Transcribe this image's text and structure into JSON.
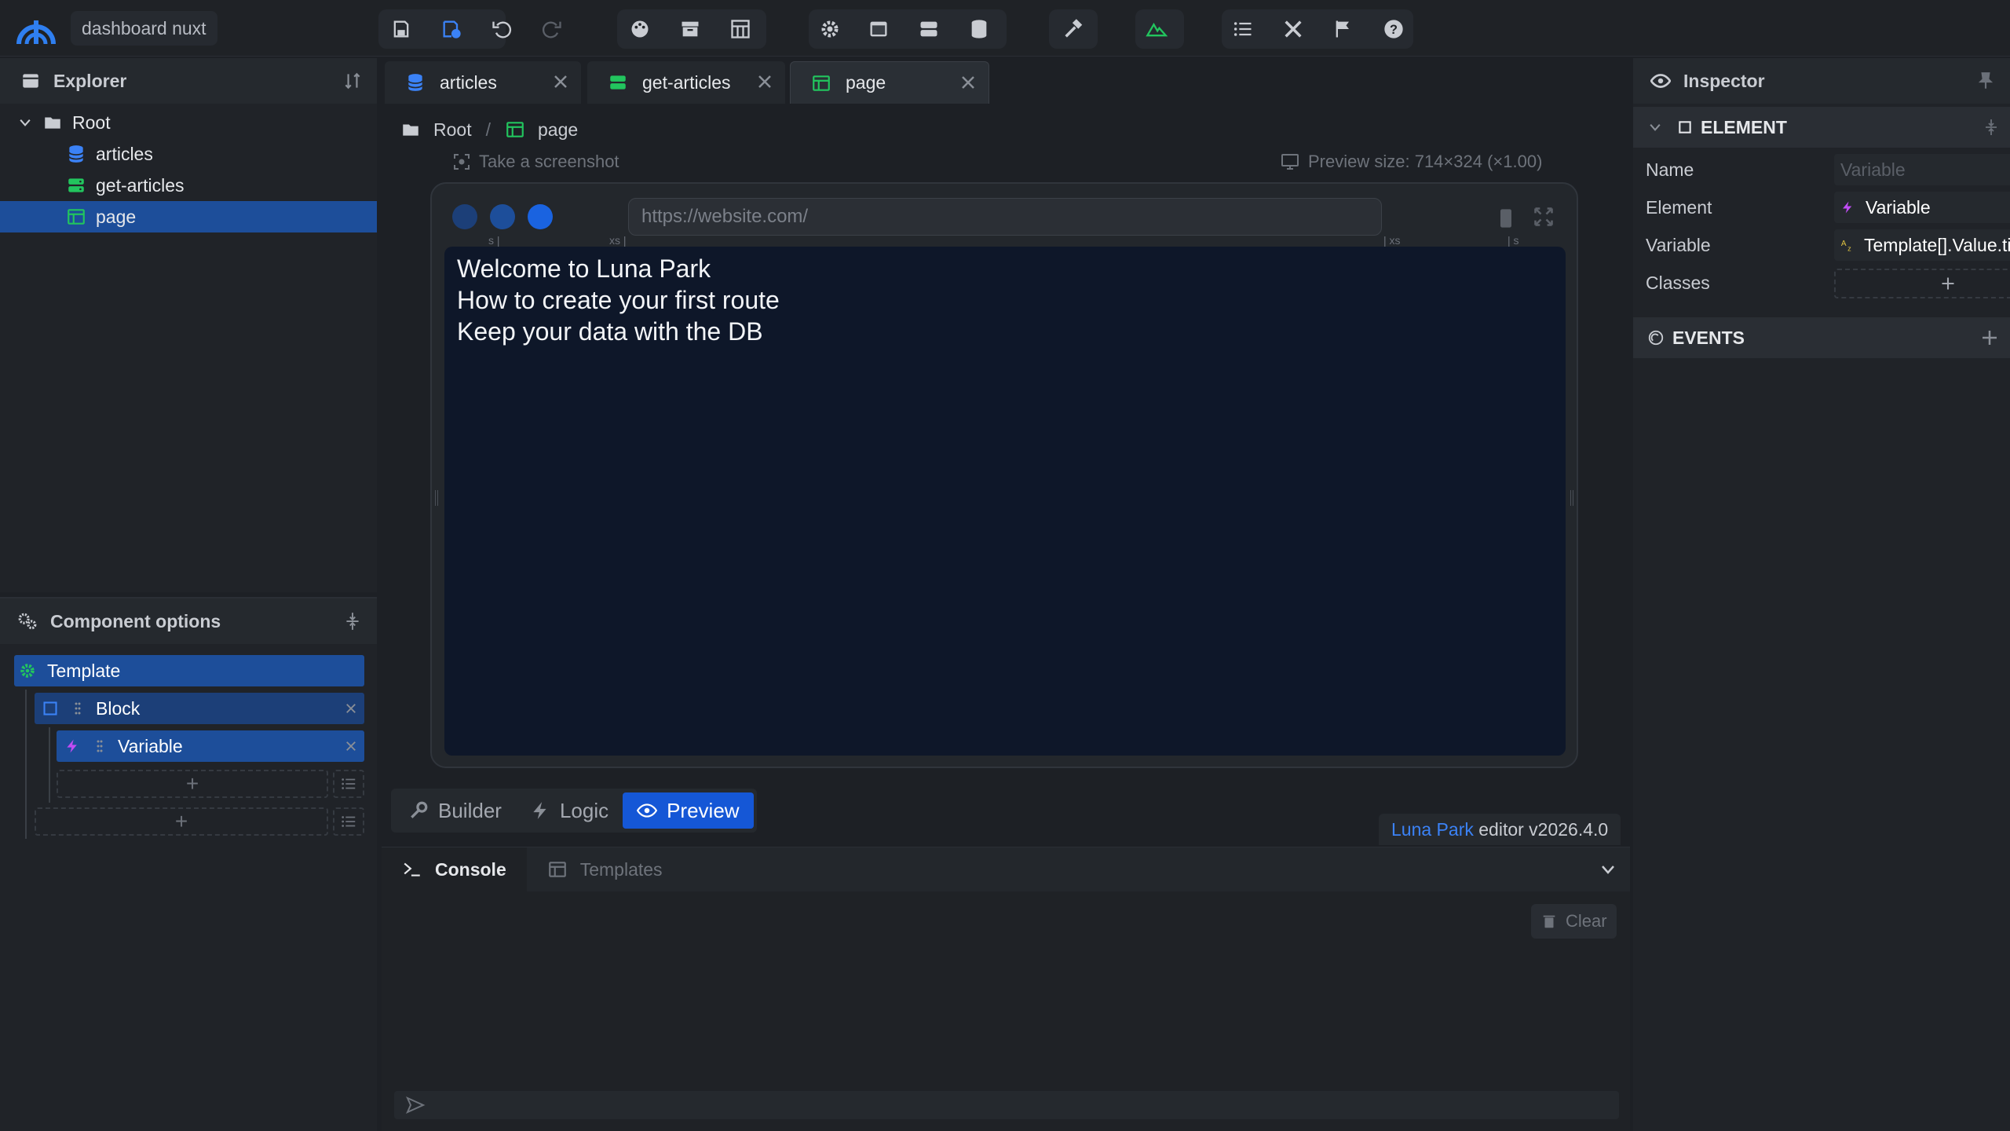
{
  "topbar": {
    "project_name": "dashboard nuxt",
    "icons": [
      "save-icon",
      "save-deploy-icon",
      "undo-icon",
      "redo-icon",
      "palette-icon",
      "archive-icon",
      "layout-icon",
      "gear-icon",
      "window-icon",
      "server-icon",
      "database-icon",
      "hammer-icon",
      "nuxt-icon",
      "list-icon",
      "tools-icon",
      "flag-icon",
      "help-icon"
    ]
  },
  "explorer": {
    "title": "Explorer",
    "root_label": "Root",
    "items": [
      {
        "label": "articles",
        "icon": "database-icon",
        "color": "#3b82f6"
      },
      {
        "label": "get-articles",
        "icon": "server-icon",
        "color": "#22c55e"
      },
      {
        "label": "page",
        "icon": "page-icon",
        "color": "#22c55e"
      }
    ]
  },
  "component_options": {
    "title": "Component options",
    "template_label": "Template",
    "block_label": "Block",
    "variable_label": "Variable",
    "add_symbol": "+"
  },
  "tabs": [
    {
      "label": "articles",
      "icon": "database-icon"
    },
    {
      "label": "get-articles",
      "icon": "server-icon"
    },
    {
      "label": "page",
      "icon": "page-icon"
    }
  ],
  "breadcrumb": {
    "root": "Root",
    "sep": "/",
    "current": "page"
  },
  "preview": {
    "screenshot_label": "Take a screenshot",
    "size_label": "Preview size: 714×324 (×1.00)",
    "url": "https://website.com/",
    "ruler": {
      "s_left": "s |",
      "xs_left": "xs |",
      "xs_right": "| xs",
      "s_right": "| s"
    },
    "content": [
      "Welcome to Luna Park",
      "How to create your first route",
      "Keep your data with the DB"
    ]
  },
  "modes": {
    "builder": "Builder",
    "logic": "Logic",
    "preview": "Preview"
  },
  "version": {
    "brand": "Luna Park",
    "text": " editor v2026.4.0"
  },
  "console": {
    "tab_console": "Console",
    "tab_templates": "Templates",
    "clear": "Clear"
  },
  "inspector": {
    "title": "Inspector",
    "element_section": "ELEMENT",
    "events_section": "EVENTS",
    "props": {
      "name_label": "Name",
      "name_placeholder": "Variable",
      "element_label": "Element",
      "element_value": "Variable",
      "variable_label": "Variable",
      "variable_value": "Template[].Value.title",
      "classes_label": "Classes"
    }
  },
  "colors": {
    "accent": "#1557d6",
    "selected": "#1d4e9a",
    "green": "#22c55e",
    "blue": "#3b82f6",
    "purple": "#c04cf4"
  }
}
